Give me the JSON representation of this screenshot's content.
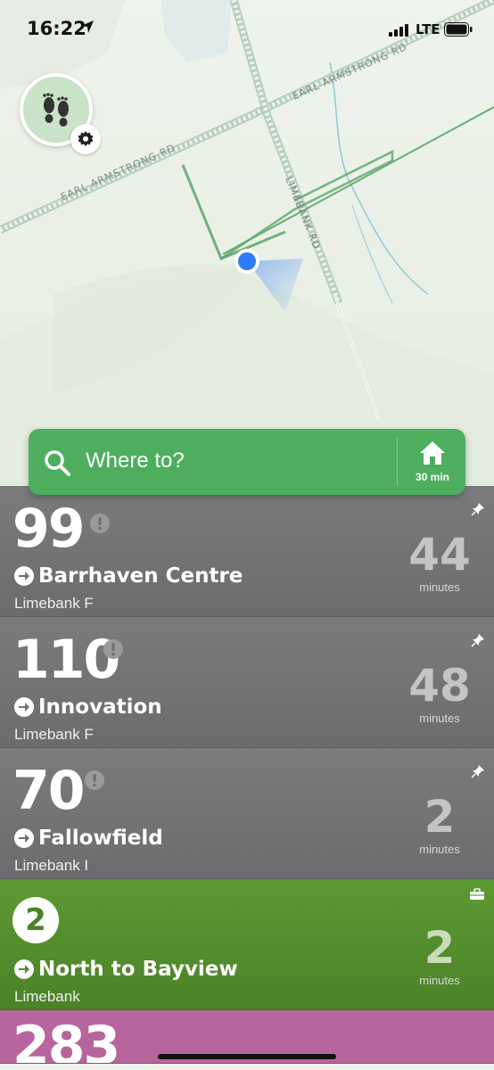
{
  "status_bar": {
    "time": "16:22",
    "network": "LTE"
  },
  "map": {
    "road_labels": [
      "EARL ARMSTRONG RD",
      "EARL ARMSTRONG RD",
      "LIMEBANK RD"
    ],
    "colors": {
      "background": "#eaf0e6",
      "route": "#5aa468",
      "location_dot": "#2e7cf6"
    }
  },
  "search": {
    "placeholder": "Where to?",
    "home_time": "30 min",
    "color": "#4dae5e"
  },
  "routes": [
    {
      "number": "99",
      "destination": "Barrhaven Centre",
      "stop": "Limebank F",
      "minutes": "44",
      "minutes_label": "minutes",
      "color": "#6f6f71",
      "has_alert": true,
      "pinned": true
    },
    {
      "number": "110",
      "destination": "Innovation",
      "stop": "Limebank F",
      "minutes": "48",
      "minutes_label": "minutes",
      "color": "#6f6f71",
      "has_alert": true,
      "pinned": true
    },
    {
      "number": "70",
      "destination": "Fallowfield",
      "stop": "Limebank I",
      "minutes": "2",
      "minutes_label": "minutes",
      "color": "#6f6f71",
      "has_alert": true,
      "pinned": true
    },
    {
      "number": "2",
      "destination": "North to Bayview",
      "stop": "Limebank",
      "minutes": "2",
      "minutes_label": "minutes",
      "color": "#4f8a2b",
      "has_alert": false,
      "pinned": false
    },
    {
      "number": "283",
      "color": "#b8659e"
    }
  ]
}
